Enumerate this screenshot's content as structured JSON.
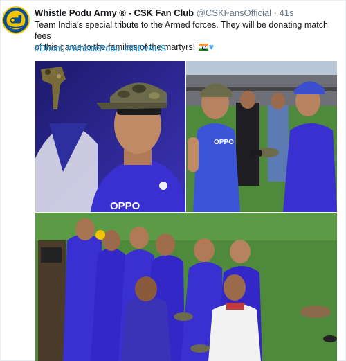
{
  "account": {
    "name": "Whistle Podu Army ® - CSK Fan Club",
    "handle": "@CSKFansOfficial",
    "separator": "·",
    "time": "41s"
  },
  "tweet": {
    "text_line_1": "Team India's special tribute to the Armed forces. They will be donating match fees",
    "text_line_2": "of this game to the families of the martyrs!",
    "hashtags": [
      "#Dhoni",
      "#WhistlePodu",
      "#INDvAUS"
    ]
  },
  "media": {
    "jersey_text_1": "OPPO",
    "jersey_text_2": "OPPO",
    "colors": {
      "jersey_blue": "#3a2fd0",
      "field_green": "#4f8a3c",
      "camo": "#6b6a4a",
      "link_blue": "#1b95e0"
    }
  },
  "icons": {
    "avatar": "csk-whistle-logo",
    "flag": "india-flag-emoji",
    "heart": "blue-heart-emoji"
  }
}
